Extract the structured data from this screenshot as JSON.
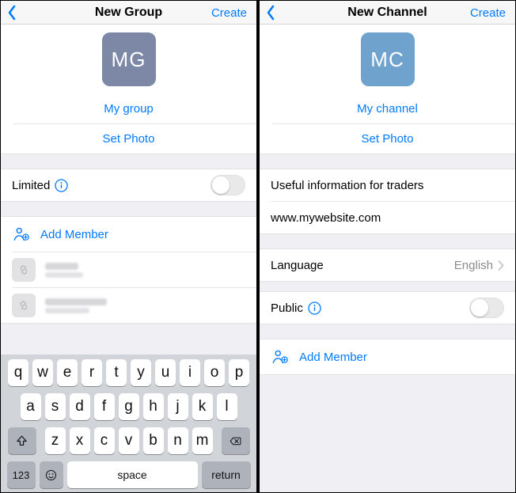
{
  "colors": {
    "accent": "#007aff",
    "avatar_mg": "#7d88a6",
    "avatar_mc": "#6fa3ce",
    "kbd_bg": "#d1d4d9",
    "kbd_fn": "#adb2bb"
  },
  "left": {
    "nav": {
      "title": "New Group",
      "create": "Create"
    },
    "avatar_initials": "MG",
    "name_value": "My group",
    "set_photo": "Set Photo",
    "limited": {
      "label": "Limited",
      "on": false
    },
    "add_member": "Add Member",
    "members": [
      {
        "name_blur_w": 42,
        "sub_blur_w": 48
      },
      {
        "name_blur_w": 78,
        "sub_blur_w": 56
      }
    ]
  },
  "right": {
    "nav": {
      "title": "New Channel",
      "create": "Create"
    },
    "avatar_initials": "MC",
    "name_value": "My channel",
    "set_photo": "Set Photo",
    "description": "Useful information for traders",
    "website": "www.mywebsite.com",
    "language": {
      "label": "Language",
      "value": "English"
    },
    "public": {
      "label": "Public",
      "on": false
    },
    "add_member": "Add Member"
  },
  "keyboard": {
    "row1": [
      "q",
      "w",
      "e",
      "r",
      "t",
      "y",
      "u",
      "i",
      "o",
      "p"
    ],
    "row2": [
      "a",
      "s",
      "d",
      "f",
      "g",
      "h",
      "j",
      "k",
      "l"
    ],
    "row3": [
      "z",
      "x",
      "c",
      "v",
      "b",
      "n",
      "m"
    ],
    "num_key": "123",
    "space": "space",
    "return": "return"
  }
}
